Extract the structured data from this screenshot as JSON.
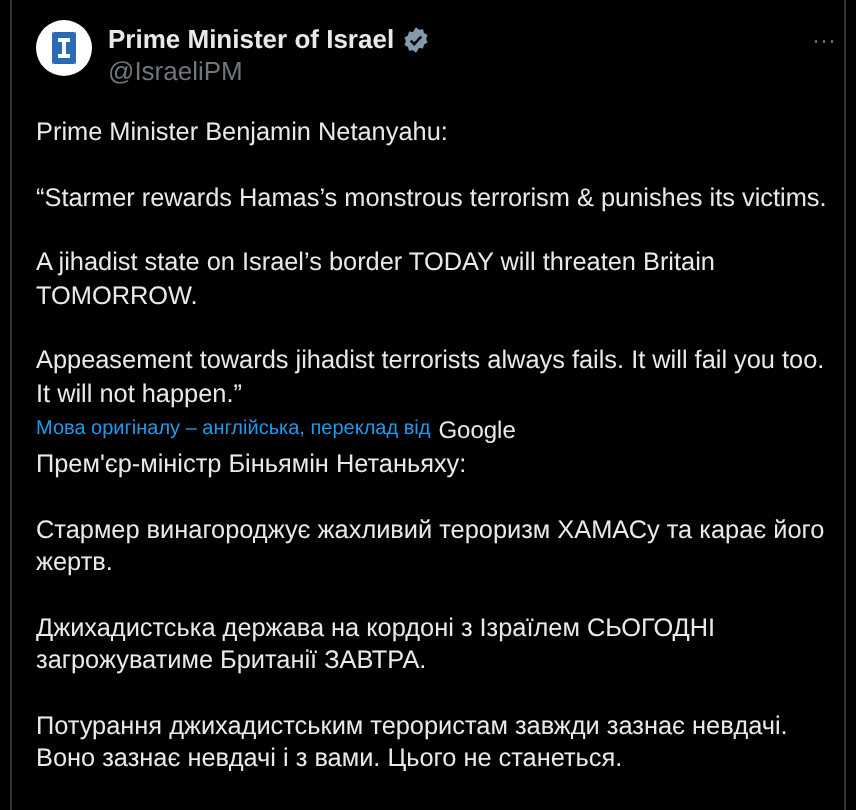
{
  "author": {
    "name": "Prime Minister of Israel",
    "handle": "@IsraeliPM",
    "verified": true
  },
  "more_menu": "···",
  "original_paragraphs": [
    "Prime Minister Benjamin Netanyahu:",
    "“Starmer rewards Hamas’s monstrous terrorism & punishes its victims.",
    "A jihadist state on Israel’s border TODAY will threaten Britain TOMORROW.",
    "Appeasement towards jihadist terrorists always fails. It will fail you too. It will not happen.”"
  ],
  "translation_notice": {
    "text": "Мова оригіналу – англійська, переклад від",
    "provider": "Google"
  },
  "translated_paragraphs": [
    "Прем'єр-міністр Біньямін Нетаньяху:",
    "Стармер винагороджує жахливий тероризм ХАМАСу та карає його жертв.",
    "Джихадистська держава на кордоні з Ізраїлем СЬОГОДНІ загрожуватиме Британії ЗАВТРА.",
    "Потурання джихадистським терористам завжди зазнає невдачі. Воно зазнає невдачі і з вами. Цього не станеться."
  ]
}
